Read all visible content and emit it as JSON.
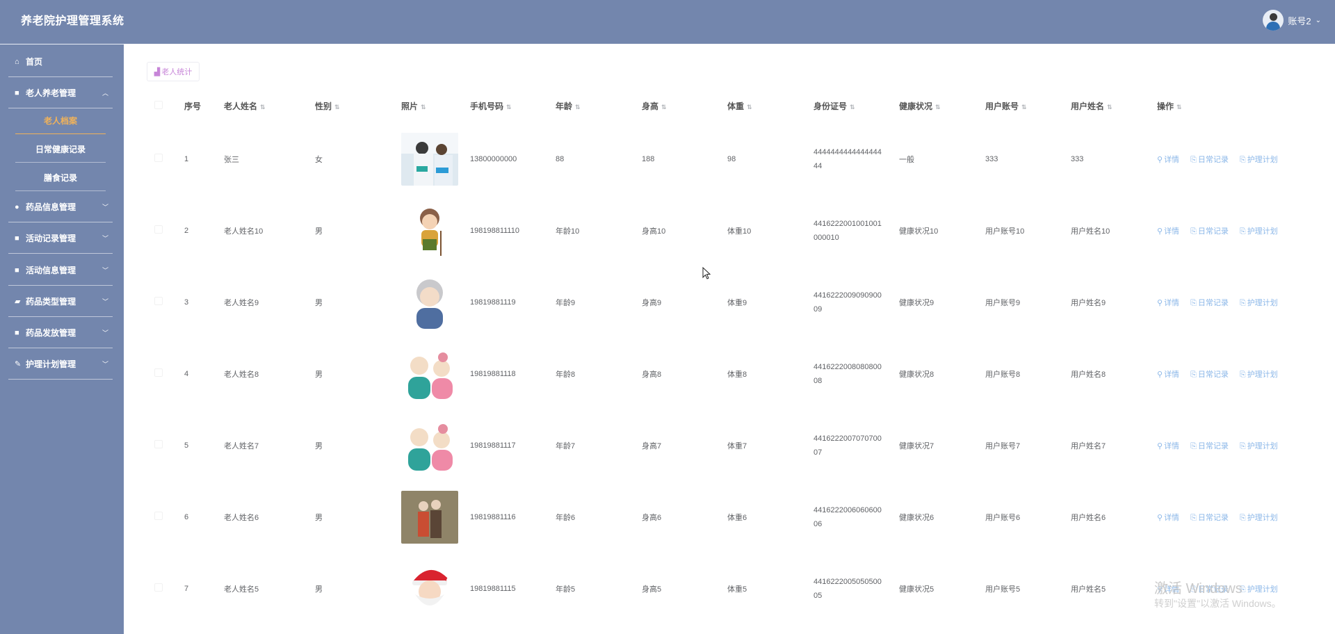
{
  "header": {
    "title": "养老院护理管理系统",
    "user": "账号2"
  },
  "sidebar": {
    "items": [
      {
        "label": "首页",
        "icon": "home-icon"
      },
      {
        "label": "老人养老管理",
        "icon": "grid-icon",
        "expanded": true
      },
      {
        "label": "药品信息管理",
        "icon": "circle-icon"
      },
      {
        "label": "活动记录管理",
        "icon": "grid-icon"
      },
      {
        "label": "活动信息管理",
        "icon": "grid-icon"
      },
      {
        "label": "药品类型管理",
        "icon": "truck-icon"
      },
      {
        "label": "药品发放管理",
        "icon": "grid-icon"
      },
      {
        "label": "护理计划管理",
        "icon": "pen-icon"
      }
    ],
    "subitems": [
      {
        "label": "老人档案",
        "active": true
      },
      {
        "label": "日常健康记录"
      },
      {
        "label": "膳食记录"
      }
    ]
  },
  "toolbar": {
    "stat_label": "老人统计"
  },
  "table": {
    "columns": [
      "序号",
      "老人姓名",
      "性别",
      "照片",
      "手机号码",
      "年龄",
      "身高",
      "体重",
      "身份证号",
      "健康状况",
      "用户账号",
      "用户姓名",
      "操作"
    ],
    "rows": [
      {
        "no": "1",
        "name": "张三",
        "gender": "女",
        "phone": "13800000000",
        "age": "88",
        "height": "188",
        "weight": "98",
        "idcard": "4444444444444444\n44",
        "health": "一般",
        "account": "333",
        "username": "333"
      },
      {
        "no": "2",
        "name": "老人姓名10",
        "gender": "男",
        "phone": "198198811110",
        "age": "年龄10",
        "height": "身高10",
        "weight": "体重10",
        "idcard": "4416222001001001\n000010",
        "health": "健康状况10",
        "account": "用户账号10",
        "username": "用户姓名10"
      },
      {
        "no": "3",
        "name": "老人姓名9",
        "gender": "男",
        "phone": "19819881119",
        "age": "年龄9",
        "height": "身高9",
        "weight": "体重9",
        "idcard": "4416222009090900\n09",
        "health": "健康状况9",
        "account": "用户账号9",
        "username": "用户姓名9"
      },
      {
        "no": "4",
        "name": "老人姓名8",
        "gender": "男",
        "phone": "19819881118",
        "age": "年龄8",
        "height": "身高8",
        "weight": "体重8",
        "idcard": "4416222008080800\n08",
        "health": "健康状况8",
        "account": "用户账号8",
        "username": "用户姓名8"
      },
      {
        "no": "5",
        "name": "老人姓名7",
        "gender": "男",
        "phone": "19819881117",
        "age": "年龄7",
        "height": "身高7",
        "weight": "体重7",
        "idcard": "4416222007070700\n07",
        "health": "健康状况7",
        "account": "用户账号7",
        "username": "用户姓名7"
      },
      {
        "no": "6",
        "name": "老人姓名6",
        "gender": "男",
        "phone": "19819881116",
        "age": "年龄6",
        "height": "身高6",
        "weight": "体重6",
        "idcard": "4416222006060600\n06",
        "health": "健康状况6",
        "account": "用户账号6",
        "username": "用户姓名6"
      },
      {
        "no": "7",
        "name": "老人姓名5",
        "gender": "男",
        "phone": "19819881115",
        "age": "年龄5",
        "height": "身高5",
        "weight": "体重5",
        "idcard": "4416222005050500\n05",
        "health": "健康状况5",
        "account": "用户账号5",
        "username": "用户姓名5"
      }
    ],
    "actions": [
      "详情",
      "日常记录",
      "护理计划"
    ]
  },
  "watermark": {
    "line1": "激活 Windows",
    "line2": "转到\"设置\"以激活 Windows。"
  }
}
